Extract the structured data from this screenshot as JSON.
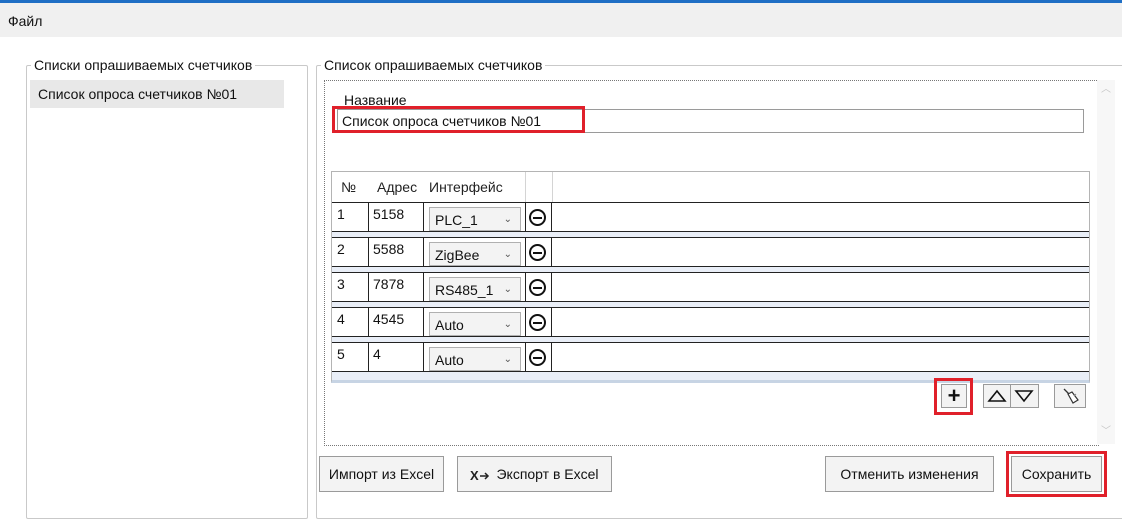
{
  "menu": {
    "file": "Файл"
  },
  "left_panel": {
    "title": "Списки опрашиваемых счетчиков",
    "items": [
      "Список опроса счетчиков №01"
    ]
  },
  "right_panel": {
    "title": "Список опрашиваемых счетчиков",
    "name_label": "Название",
    "name_value": "Список опроса счетчиков №01"
  },
  "grid": {
    "columns": [
      "№",
      "Адрес",
      "Интерфейс"
    ],
    "rows": [
      {
        "num": "1",
        "address": "5158",
        "interface": "PLC_1"
      },
      {
        "num": "2",
        "address": "5588",
        "interface": "ZigBee"
      },
      {
        "num": "3",
        "address": "7878",
        "interface": "RS485_1"
      },
      {
        "num": "4",
        "address": "4545",
        "interface": "Auto"
      },
      {
        "num": "5",
        "address": "4",
        "interface": "Auto"
      }
    ]
  },
  "buttons": {
    "import": "Импорт из Excel",
    "export": "Экспорт в Excel",
    "cancel": "Отменить изменения",
    "save": "Сохранить"
  },
  "colors": {
    "highlight": "#e0202a",
    "accent": "#1f6fc5"
  }
}
